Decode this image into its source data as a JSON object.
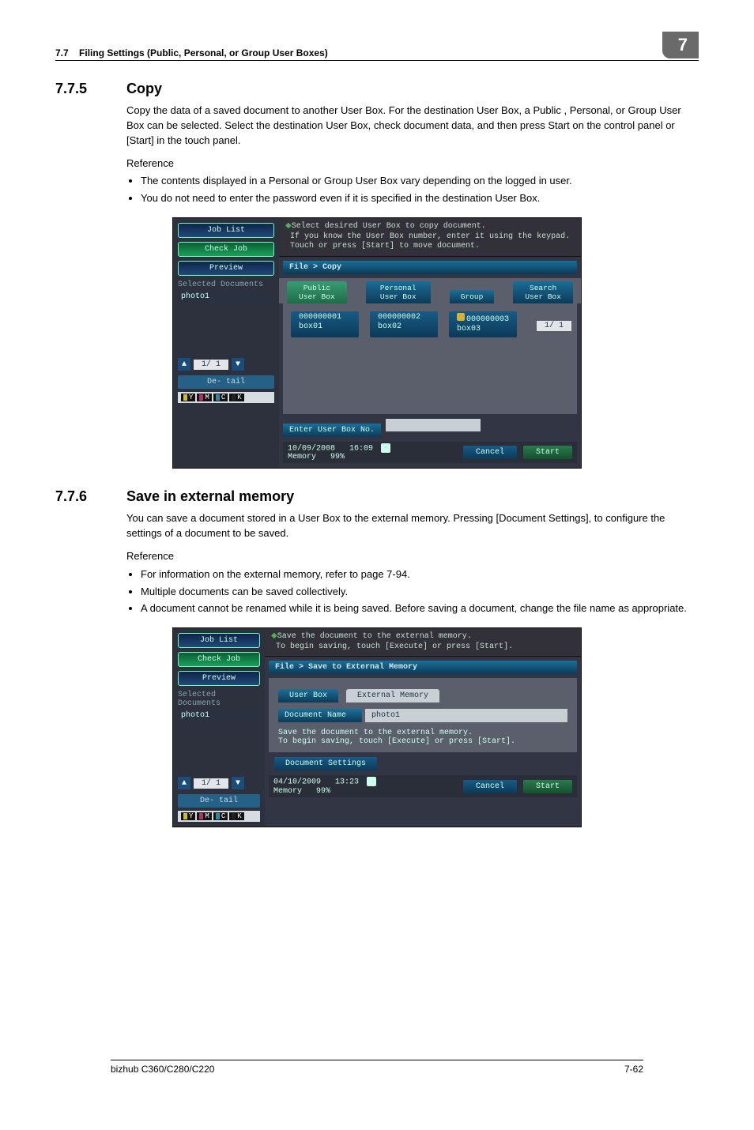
{
  "header": {
    "section_no": "7.7",
    "section_title": "Filing Settings (Public, Personal, or Group User Boxes)",
    "chapter_no": "7"
  },
  "sect1": {
    "num": "7.7.5",
    "title": "Copy",
    "para": "Copy the data of a saved document to another User Box. For the destination User Box, a Public , Personal, or Group User Box can be selected. Select the destination User Box, check document data, and then press Start on the control panel or [Start] in the touch panel.",
    "ref_label": "Reference",
    "bullets": [
      "The contents displayed in a Personal or Group User Box vary depending on the logged in user.",
      "You do not need to enter the password even if it is specified in the destination User Box."
    ]
  },
  "panel1": {
    "side": {
      "job_list": "Job List",
      "check_job": "Check Job",
      "preview": "Preview",
      "sel_docs": "Selected Documents",
      "doc": "photo1",
      "pager": "1/ 1",
      "detail": "De-\ntail"
    },
    "guide1": "Select desired User Box to copy document.",
    "guide2": "If you know the User Box number, enter it using the keypad.",
    "guide3": "Touch or press [Start] to move document.",
    "crumb": "File > Copy",
    "tabs": {
      "public": "Public\nUser Box",
      "personal": "Personal\nUser Box",
      "group": "Group",
      "search": "Search\nUser Box"
    },
    "boxes": [
      {
        "id": "000000001",
        "name": "box01"
      },
      {
        "id": "000000002",
        "name": "box02"
      },
      {
        "id": "000000003",
        "name": "box03",
        "locked": true
      }
    ],
    "rhs_pager": "1/ 1",
    "enter_label": "Enter User Box No.",
    "footer": {
      "date": "10/09/2008",
      "time": "16:09",
      "memory": "Memory",
      "mempct": "99%",
      "cancel": "Cancel",
      "start": "Start"
    },
    "toner": {
      "Y": "Y",
      "M": "M",
      "C": "C",
      "K": "K"
    }
  },
  "sect2": {
    "num": "7.7.6",
    "title": "Save in external memory",
    "para": "You can save a document stored in a User Box to the external memory. Pressing [Document Settings], to configure the settings of a document to be saved.",
    "ref_label": "Reference",
    "bullets": [
      "For information on the external memory, refer to page 7-94.",
      "Multiple documents can be saved collectively.",
      "A document cannot be renamed while it is being saved. Before saving a document, change the file name as appropriate."
    ]
  },
  "panel2": {
    "side": {
      "job_list": "Job List",
      "check_job": "Check Job",
      "preview": "Preview",
      "sel_docs": "Selected Documents",
      "doc": "photo1",
      "pager": "1/ 1",
      "detail": "De-\ntail"
    },
    "guide1": "Save the document to the external memory.",
    "guide2": "To begin saving, touch [Execute] or press [Start].",
    "crumb": "File > Save to External Memory",
    "sec_tabs": {
      "userbox": "User Box",
      "extmem": "External Memory"
    },
    "docname_label": "Document Name",
    "docname_value": "photo1",
    "small_guide1": "Save the document to the external memory.",
    "small_guide2": "To begin saving, touch [Execute] or press [Start].",
    "docset": "Document\nSettings",
    "footer": {
      "date": "04/10/2009",
      "time": "13:23",
      "memory": "Memory",
      "mempct": "99%",
      "cancel": "Cancel",
      "start": "Start"
    },
    "toner": {
      "Y": "Y",
      "M": "M",
      "C": "C",
      "K": "K"
    }
  },
  "footer": {
    "left": "bizhub C360/C280/C220",
    "right": "7-62"
  }
}
